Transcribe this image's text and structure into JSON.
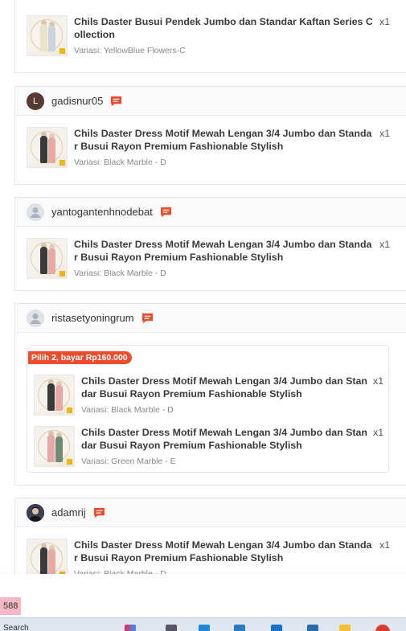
{
  "orders": [
    {
      "items": [
        {
          "title": "Chils Daster Busui Pendek Jumbo dan Standar Kaftan Series Collection",
          "qty": "x1",
          "variant": "Variasi: YellowBlue Flowers-C"
        }
      ]
    },
    {
      "username": "gadisnur05",
      "avatar_letter": "L",
      "items": [
        {
          "title": "Chils Daster Dress Motif Mewah Lengan 3/4 Jumbo dan Standar Busui Rayon Premium Fashionable Stylish",
          "qty": "x1",
          "variant": "Variasi: Black Marble - D"
        }
      ]
    },
    {
      "username": "yantogantenhnodebat",
      "items": [
        {
          "title": "Chils Daster Dress Motif Mewah Lengan 3/4 Jumbo dan Standar Busui Rayon Premium Fashionable Stylish",
          "qty": "x1",
          "variant": "Variasi: Black Marble - D"
        }
      ]
    },
    {
      "username": "ristasetyoningrum",
      "promo": "Pilih 2, bayar Rp160.000",
      "items": [
        {
          "title": "Chils Daster Dress Motif Mewah Lengan 3/4 Jumbo dan Standar Busui Rayon Premium Fashionable Stylish",
          "qty": "x1",
          "variant": "Variasi: Black Marble - D"
        },
        {
          "title": "Chils Daster Dress Motif Mewah Lengan 3/4 Jumbo dan Standar Busui Rayon Premium Fashionable Stylish",
          "qty": "x1",
          "variant": "Variasi: Green Marble - E"
        }
      ]
    },
    {
      "username": "adamrij",
      "items": [
        {
          "title": "Chils Daster Dress Motif Mewah Lengan 3/4 Jumbo dan Standar Busui Rayon Premium Fashionable Stylish",
          "qty": "x1",
          "variant": "Variasi: Black Marble - D"
        }
      ]
    }
  ],
  "page_indicator": "588",
  "taskbar": {
    "search_label": "Search"
  },
  "colors": {
    "accent": "#ee4d2d",
    "chat_icon": "#ee4d2d"
  }
}
